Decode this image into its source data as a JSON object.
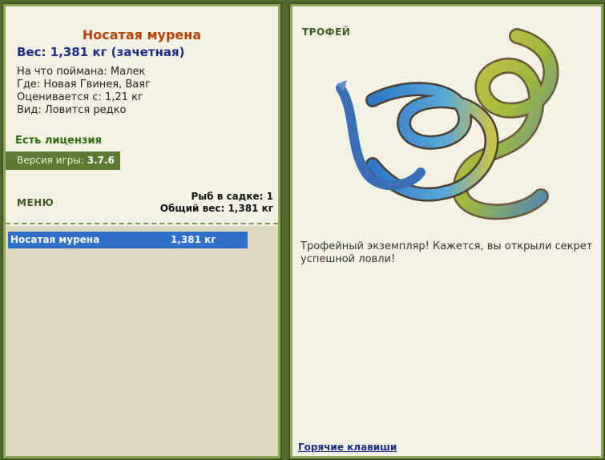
{
  "fish": {
    "name": "Носатая мурена",
    "weight_line": "Вес: 1,381 кг (зачетная)",
    "bait": "На что поймана: Малек",
    "location": "Где: Новая Гвинея, Ваяг",
    "value": "Оценивается с: 1,21 кг",
    "rarity": "Вид: Ловится редко"
  },
  "license": "Есть лицензия",
  "version": {
    "label": "Версия игры:",
    "number": "3.7.6"
  },
  "menu_label": "МЕНЮ",
  "catch": {
    "count": "Рыб в садке: 1",
    "total": "Общий вес: 1,381 кг"
  },
  "fish_list": [
    {
      "name": "Носатая мурена",
      "weight": "1,381 кг"
    }
  ],
  "trophy": {
    "label": "ТРОФЕЙ",
    "text": "Трофейный экземпляр! Кажется, вы открыли секрет успешной ловли!"
  },
  "hotkeys": "Горячие клавиши",
  "colors": {
    "accent_green": "#5c7a34",
    "title_orange": "#b5410a",
    "selection_blue": "#2f6fc8"
  }
}
